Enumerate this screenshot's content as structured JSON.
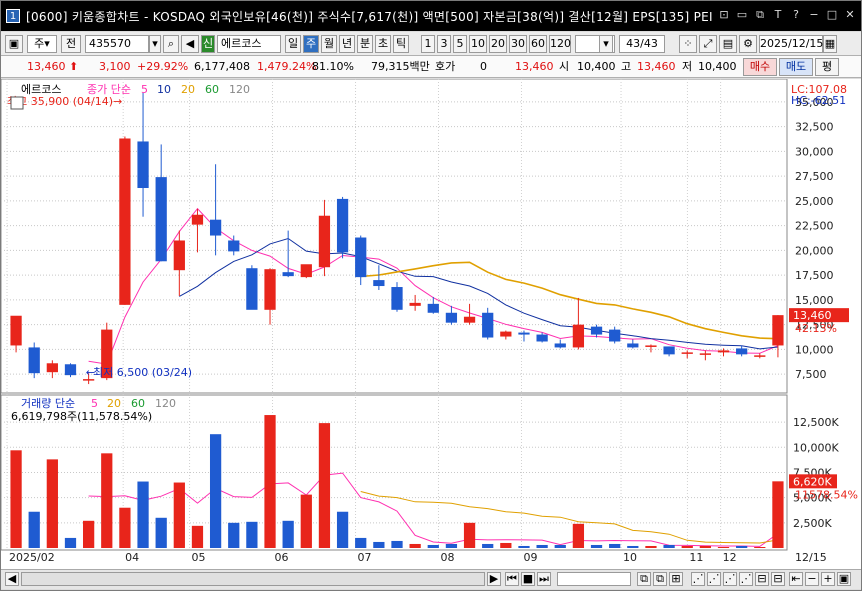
{
  "window": {
    "number": "1",
    "title": "[0600] 키움종합차트 - KOSDAQ 외국인보유[46(천)] 주식수[7,617(천)] 액면[500] 자본금[38(억)] 결산[12월] EPS[135] PEI"
  },
  "toolbar": {
    "period_select": "주",
    "prev_label": "전",
    "code": "435570",
    "market_badge": "신",
    "name": "에르코스",
    "periods": [
      "일",
      "주",
      "월",
      "년",
      "분",
      "초",
      "틱"
    ],
    "active_period": "주",
    "intervals": [
      "1",
      "3",
      "5",
      "10",
      "20",
      "30",
      "60",
      "120"
    ],
    "page": "43/43",
    "date": "2025/12/15"
  },
  "quote": {
    "price": "13,460",
    "change": "3,100",
    "change_pct": "+29.92%",
    "volume": "6,177,408",
    "volume_ratio": "1,479.24%",
    "turnover": "81.10%",
    "amount": "79,315백만",
    "hoga_label": "호가",
    "hoga": "0",
    "price2": "13,460",
    "open_label": "시",
    "open": "10,400",
    "high_label": "고",
    "high": "13,460",
    "low_label": "저",
    "low": "10,400",
    "buy_label": "매수",
    "sell_label": "매도",
    "eval_label": "평"
  },
  "colors": {
    "up": "#e8251b",
    "down": "#1f5bd1",
    "ma5": "#ff30b0",
    "ma10": "#1030a0",
    "ma20": "#e0a000",
    "ma60": "#1a9a30",
    "ma120": "#888888"
  },
  "price_panel": {
    "legend_name": "에르코스",
    "legend_ma": [
      "종가 단순",
      "5",
      "10",
      "20",
      "60",
      "120"
    ],
    "max_label": "최고 35,900 (04/14)",
    "min_label": "최저 6,500 (03/24)",
    "lc": "LC:107.08",
    "hc": "HC:-62.51",
    "price_tag": "13,460",
    "pct_tag": "42.13%",
    "y_labels": [
      "35,000",
      "32,500",
      "30,000",
      "27,500",
      "25,000",
      "22,500",
      "20,000",
      "17,500",
      "15,000",
      "12,500",
      "10,000",
      "7,500"
    ]
  },
  "volume_panel": {
    "legend": [
      "거래량 단순",
      "5",
      "20",
      "60",
      "120"
    ],
    "info": "6,619,798주(11,578.54%)",
    "tag": "6,620K",
    "tag2": "11578.54%",
    "y_labels": [
      "12,500K",
      "10,000K",
      "7,500K",
      "5,000K",
      "2,500K"
    ]
  },
  "x_axis": [
    "2025/02",
    "04",
    "05",
    "06",
    "07",
    "08",
    "09",
    "10",
    "11",
    "12",
    "12/15"
  ],
  "chart_data": {
    "type": "candlestick",
    "interval": "weekly",
    "ylim": [
      5800,
      36500
    ],
    "vlim": [
      0,
      14000000
    ],
    "candles": [
      {
        "o": 10400,
        "h": 12200,
        "l": 9700,
        "c": 13400,
        "v": 9700000
      },
      {
        "o": 10200,
        "h": 10700,
        "l": 7100,
        "c": 7600,
        "v": 3600000
      },
      {
        "o": 7700,
        "h": 8900,
        "l": 7100,
        "c": 8600,
        "v": 8800000
      },
      {
        "o": 8500,
        "h": 8600,
        "l": 7200,
        "c": 7400,
        "v": 1000000
      },
      {
        "o": 7000,
        "h": 7600,
        "l": 6500,
        "c": 7000,
        "v": 2700000
      },
      {
        "o": 7100,
        "h": 12700,
        "l": 6900,
        "c": 12000,
        "v": 9400000
      },
      {
        "o": 14500,
        "h": 31500,
        "l": 14500,
        "c": 31300,
        "v": 4000000
      },
      {
        "o": 31000,
        "h": 35900,
        "l": 23400,
        "c": 26300,
        "v": 6600000
      },
      {
        "o": 27400,
        "h": 30700,
        "l": 18900,
        "c": 18900,
        "v": 3000000
      },
      {
        "o": 18000,
        "h": 22000,
        "l": 15400,
        "c": 21000,
        "v": 6500000
      },
      {
        "o": 22600,
        "h": 24200,
        "l": 19800,
        "c": 23600,
        "v": 2200000
      },
      {
        "o": 23100,
        "h": 28700,
        "l": 19500,
        "c": 21500,
        "v": 11300000
      },
      {
        "o": 21000,
        "h": 21500,
        "l": 19500,
        "c": 19900,
        "v": 2500000
      },
      {
        "o": 18200,
        "h": 18500,
        "l": 14200,
        "c": 14000,
        "v": 2600000
      },
      {
        "o": 14000,
        "h": 18200,
        "l": 12500,
        "c": 18100,
        "v": 13200000
      },
      {
        "o": 17800,
        "h": 22000,
        "l": 17300,
        "c": 17400,
        "v": 2700000
      },
      {
        "o": 17300,
        "h": 18500,
        "l": 17200,
        "c": 18600,
        "v": 5300000
      },
      {
        "o": 18300,
        "h": 25100,
        "l": 17400,
        "c": 23500,
        "v": 12400000
      },
      {
        "o": 25200,
        "h": 25400,
        "l": 19200,
        "c": 19800,
        "v": 3600000
      },
      {
        "o": 21300,
        "h": 21500,
        "l": 16500,
        "c": 17300,
        "v": 1000000
      },
      {
        "o": 17000,
        "h": 18500,
        "l": 16000,
        "c": 16400,
        "v": 600000
      },
      {
        "o": 16300,
        "h": 16800,
        "l": 13800,
        "c": 14000,
        "v": 700000
      },
      {
        "o": 14400,
        "h": 15500,
        "l": 13900,
        "c": 14700,
        "v": 400000
      },
      {
        "o": 14600,
        "h": 15300,
        "l": 13600,
        "c": 13700,
        "v": 300000
      },
      {
        "o": 13700,
        "h": 14400,
        "l": 12500,
        "c": 12700,
        "v": 400000
      },
      {
        "o": 12700,
        "h": 14600,
        "l": 12500,
        "c": 13300,
        "v": 2500000
      },
      {
        "o": 13700,
        "h": 14200,
        "l": 11000,
        "c": 11200,
        "v": 400000
      },
      {
        "o": 11300,
        "h": 11900,
        "l": 11000,
        "c": 11800,
        "v": 500000
      },
      {
        "o": 11700,
        "h": 11900,
        "l": 10800,
        "c": 11500,
        "v": 200000
      },
      {
        "o": 11500,
        "h": 11700,
        "l": 10700,
        "c": 10800,
        "v": 300000
      },
      {
        "o": 10600,
        "h": 11000,
        "l": 10100,
        "c": 10200,
        "v": 300000
      },
      {
        "o": 10200,
        "h": 15200,
        "l": 10000,
        "c": 12500,
        "v": 2400000
      },
      {
        "o": 12300,
        "h": 12500,
        "l": 11200,
        "c": 11500,
        "v": 300000
      },
      {
        "o": 12000,
        "h": 12300,
        "l": 10600,
        "c": 10800,
        "v": 400000
      },
      {
        "o": 10600,
        "h": 11000,
        "l": 10100,
        "c": 10200,
        "v": 200000
      },
      {
        "o": 10300,
        "h": 10500,
        "l": 9700,
        "c": 10400,
        "v": 200000
      },
      {
        "o": 10300,
        "h": 10300,
        "l": 9300,
        "c": 9500,
        "v": 300000
      },
      {
        "o": 9600,
        "h": 9900,
        "l": 9100,
        "c": 9700,
        "v": 200000
      },
      {
        "o": 9600,
        "h": 9900,
        "l": 8900,
        "c": 9600,
        "v": 200000
      },
      {
        "o": 9700,
        "h": 10100,
        "l": 9300,
        "c": 9900,
        "v": 100000
      },
      {
        "o": 10100,
        "h": 10400,
        "l": 9300,
        "c": 9500,
        "v": 200000
      },
      {
        "o": 9400,
        "h": 9600,
        "l": 9100,
        "c": 9400,
        "v": 100000
      },
      {
        "o": 10400,
        "h": 13460,
        "l": 9200,
        "c": 13460,
        "v": 6620000
      }
    ]
  }
}
